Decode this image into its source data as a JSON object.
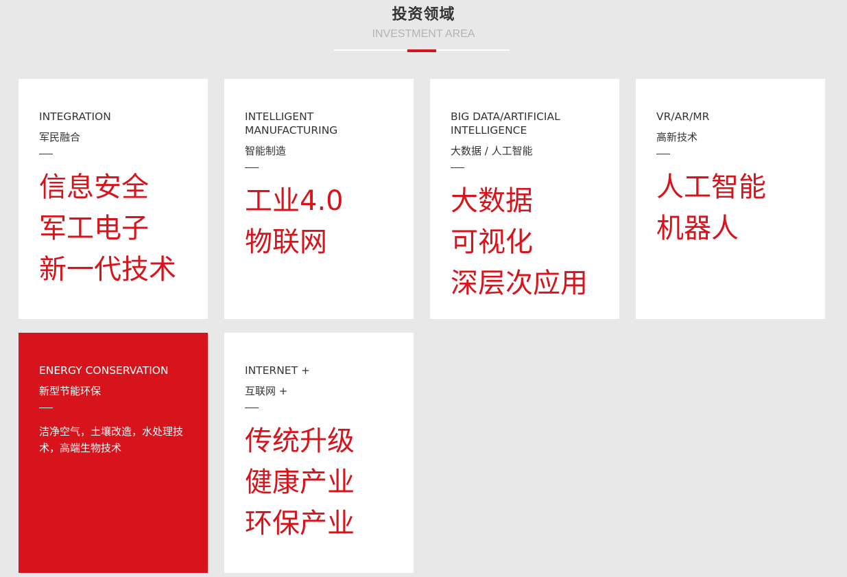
{
  "header": {
    "title": "投资领域",
    "subtitle": "INVESTMENT AREA"
  },
  "colors": {
    "accent": "#d7141b",
    "background": "#e8e8e8",
    "card": "#ffffff",
    "text": "#333333"
  },
  "cards": [
    {
      "en": "INTEGRATION",
      "cn": "军民融合",
      "items": [
        "信息安全",
        "军工电子",
        "新一代技术"
      ]
    },
    {
      "en": "INTELLIGENT MANUFACTURING",
      "cn": "智能制造",
      "items": [
        "工业4.0",
        "物联网"
      ]
    },
    {
      "en": "BIG DATA/ARTIFICIAL INTELLIGENCE",
      "cn": "大数据 / 人工智能",
      "items": [
        "大数据",
        "可视化",
        "深层次应用"
      ]
    },
    {
      "en": "VR/AR/MR",
      "cn": "高新技术",
      "items": [
        "人工智能",
        "机器人"
      ]
    },
    {
      "en": "ENERGY CONSERVATION",
      "cn": "新型节能环保",
      "desc": "洁净空气，土壤改造，水处理技术，高端生物技术"
    },
    {
      "en": "INTERNET +",
      "cn": "互联网 +",
      "items": [
        "传统升级",
        "健康产业",
        "环保产业"
      ]
    }
  ]
}
